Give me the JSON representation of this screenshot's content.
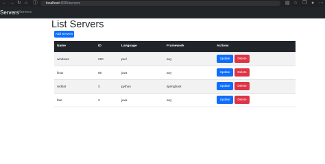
{
  "browser": {
    "url_host": "localhost",
    "url_path": ":4025/servers"
  },
  "navbar": {
    "brand": "Servers",
    "link": "Servers"
  },
  "page": {
    "title": "List Servers",
    "add_button": "Add Servers"
  },
  "table": {
    "headers": [
      "Name",
      "ID",
      "Language",
      "Framework",
      "Actions"
    ],
    "rows": [
      {
        "name": "windows",
        "id": "220",
        "language": "perl",
        "framework": "any"
      },
      {
        "name": "linux",
        "id": "89",
        "language": "java",
        "framework": "any"
      },
      {
        "name": "redhat",
        "id": "3",
        "language": "python",
        "framework": "springboot"
      },
      {
        "name": "fate",
        "id": "3",
        "language": "java",
        "framework": "any"
      }
    ],
    "update_label": "Update",
    "delete_label": "Delete"
  },
  "colors": {
    "primary": "#0d6efd",
    "danger": "#dc3545",
    "dark": "#212529"
  }
}
